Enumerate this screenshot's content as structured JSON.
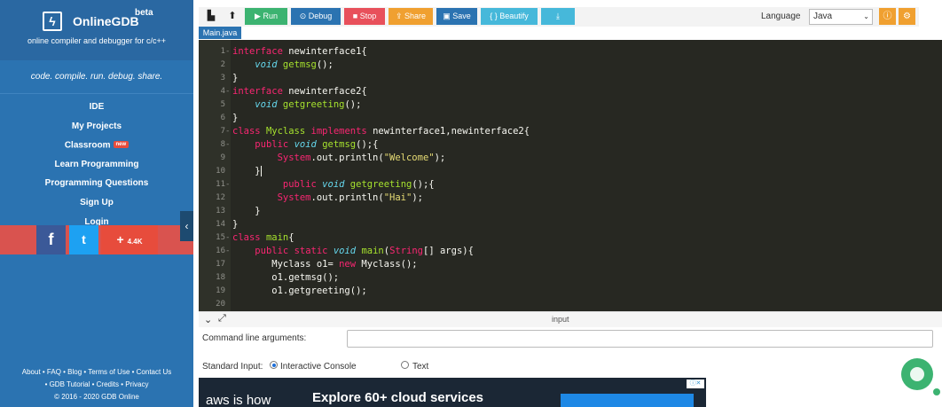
{
  "brand": {
    "name": "OnlineGDB",
    "beta": "beta",
    "tagline": "online compiler and debugger for c/c++",
    "slogan": "code. compile. run. debug. share.",
    "logo_glyph": "ϟ"
  },
  "nav": {
    "ide": "IDE",
    "my_projects": "My Projects",
    "classroom": "Classroom",
    "classroom_badge": "new",
    "learn": "Learn Programming",
    "questions": "Programming Questions",
    "signup": "Sign Up",
    "login": "Login"
  },
  "social": {
    "facebook": "f",
    "twitter": "t",
    "plus": "+",
    "count": "4.4K"
  },
  "collapse_glyph": "‹",
  "footer": {
    "line1": "About • FAQ • Blog • Terms of Use • Contact Us",
    "line2": "• GDB Tutorial • Credits • Privacy",
    "line3": "© 2016 - 2020 GDB Online"
  },
  "toolbar": {
    "file_icon": "▙",
    "upload_icon": "⬆",
    "run": "▶ Run",
    "debug": "⊙ Debug",
    "stop": "■ Stop",
    "share": "⇪ Share",
    "save": "▣ Save",
    "beautify": "{ } Beautify",
    "download": "⤓",
    "language_label": "Language",
    "language_value": "Java",
    "caret": "⌄",
    "info_icon": "ⓘ",
    "settings_icon": "⚙"
  },
  "colors": {
    "run": "#3cb371",
    "debug": "#2b73b1",
    "stop": "#e8505b",
    "share": "#f0a030",
    "save": "#2b73b1",
    "beautify": "#46b8da",
    "download": "#46b8da"
  },
  "editor": {
    "file_tab": "Main.java",
    "line_numbers": [
      "1",
      "2",
      "3",
      "4",
      "5",
      "6",
      "7",
      "8",
      "9",
      "10",
      "11",
      "12",
      "13",
      "14",
      "15",
      "16",
      "17",
      "18",
      "19",
      "20"
    ],
    "fold_markers": [
      "-",
      "",
      "",
      "-",
      "",
      "",
      "-",
      "-",
      "",
      "",
      "-",
      "",
      "",
      "",
      "-",
      "-",
      "",
      "",
      "",
      ""
    ]
  },
  "input": {
    "title": "input",
    "chevron": "⌄",
    "expand": "⤢",
    "cmd_label": "Command line arguments:",
    "stdin_label": "Standard Input:",
    "opt_interactive": "Interactive Console",
    "opt_text": "Text"
  },
  "ad": {
    "lead": "aws is how",
    "headline": "Explore 60+ cloud services",
    "badge": "ⓘ✕"
  }
}
